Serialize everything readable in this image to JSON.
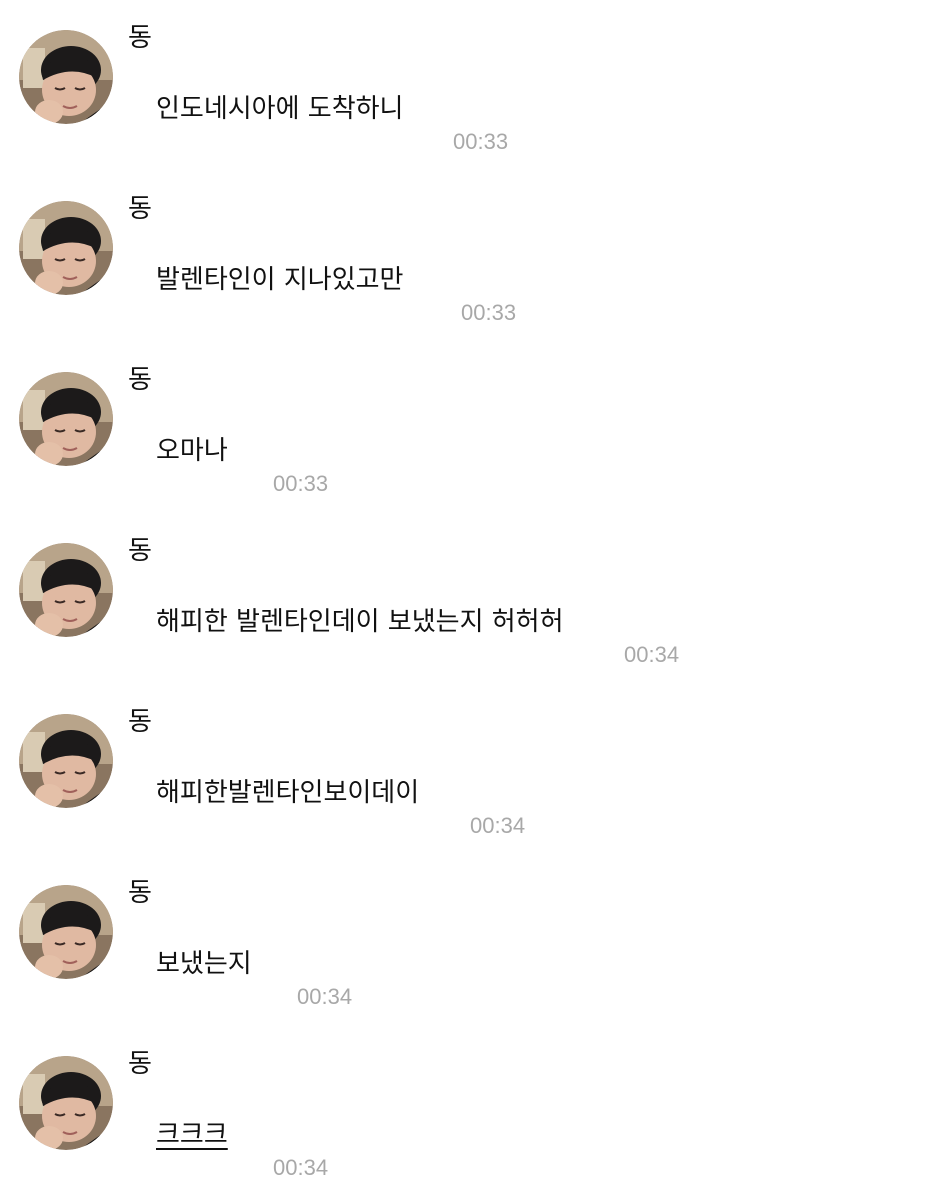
{
  "messages": [
    {
      "sender": "동",
      "text": "인도네시아에 도착하니",
      "time": "00:33"
    },
    {
      "sender": "동",
      "text": "발렌타인이 지나있고만",
      "time": "00:33"
    },
    {
      "sender": "동",
      "text": "오마나",
      "time": "00:33"
    },
    {
      "sender": "동",
      "text": "해피한 발렌타인데이 보냈는지 허허허",
      "time": "00:34"
    },
    {
      "sender": "동",
      "text": "해피한발렌타인보이데이",
      "time": "00:34"
    },
    {
      "sender": "동",
      "text": "보냈는지",
      "time": "00:34"
    },
    {
      "sender": "동",
      "text": "크크크",
      "time": "00:34"
    }
  ]
}
